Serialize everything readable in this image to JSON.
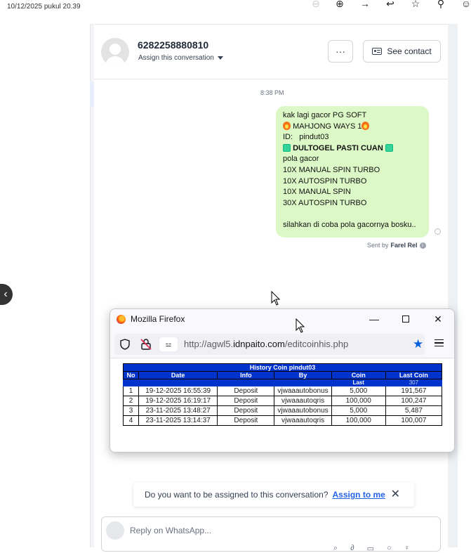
{
  "top": {
    "timestamp": "10/12/2025 pukul 20.39"
  },
  "header": {
    "contact_number": "6282258880810",
    "assign_label": "Assign this conversation",
    "more_label": "···",
    "see_contact_label": "See contact"
  },
  "message": {
    "time": "8:38 PM",
    "lines": [
      "kak lagi gacor PG SOFT",
      "MAHJONG WAYS 1",
      "ID:   pindut03",
      "DULTOGEL PASTI CUAN",
      "pola gacor",
      "10X MANUAL SPIN TURBO",
      "10X AUTOSPIN TURBO",
      "10X MANUAL SPIN",
      "30X AUTOSPIN TURBO",
      "",
      "silahkan di coba pola gacornya bosku.."
    ],
    "sent_by_prefix": "Sent by",
    "sent_by_name": "Farel Rel"
  },
  "firefox": {
    "title": "Mozilla Firefox",
    "url_prefix": "http://agwl5.",
    "url_domain": "idnpaito.com",
    "url_path": "/editcoinhis.php",
    "table": {
      "caption": "History Coin pindut03",
      "headers": [
        "No",
        "Date",
        "Info",
        "By",
        "Coin",
        "Last Coin"
      ],
      "sub_last_label": "Last",
      "sub_last_value": "307",
      "rows": [
        [
          "1",
          "19-12-2025 16:55:39",
          "Deposit",
          "vjwaaautobonus",
          "5,000",
          "191,567"
        ],
        [
          "2",
          "19-12-2025 16:19:17",
          "Deposit",
          "vjwaaautoqris",
          "100,000",
          "100,247"
        ],
        [
          "3",
          "23-11-2025 13:48:27",
          "Deposit",
          "vjwaaautobonus",
          "5,000",
          "5,487"
        ],
        [
          "4",
          "23-11-2025 13:14:37",
          "Deposit",
          "vjwaaautoqris",
          "100,000",
          "100,007"
        ]
      ]
    }
  },
  "assign_bar": {
    "question": "Do you want to be assigned to this conversation?",
    "link": "Assign to me",
    "close": "✕"
  },
  "reply": {
    "placeholder": "Reply on WhatsApp..."
  },
  "icons": {
    "back": "chevron-left-icon",
    "toolbar": [
      "zoom-out-icon",
      "zoom-in-icon",
      "forward-icon",
      "reply-icon",
      "star-icon",
      "pin-icon",
      "emoji-icon"
    ]
  },
  "colors": {
    "bubble": "#dcf8c6",
    "link": "#2563eb",
    "table_header": "#0033cc"
  }
}
